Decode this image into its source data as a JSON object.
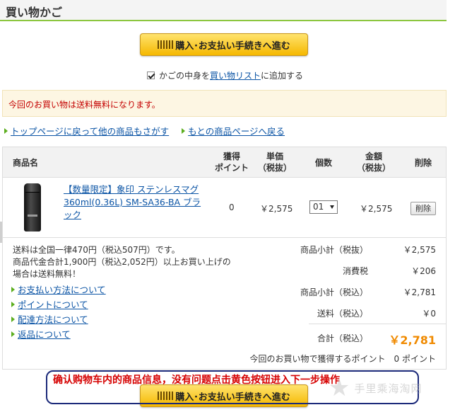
{
  "header": {
    "title": "買い物かご"
  },
  "buttons": {
    "checkout_top": "購入･お支払い手続きへ進む",
    "checkout_bottom": "購入･お支払い手続きへ進む"
  },
  "wishlist": {
    "checked": true,
    "prefix": "かごの中身を",
    "link": "買い物リスト",
    "suffix": "に追加する"
  },
  "notice": "今回のお買い物は送料無料になります。",
  "nav_links": [
    "トップページに戻って他の商品もさがす",
    "もとの商品ページへ戻る"
  ],
  "table": {
    "headers": {
      "product": "商品名",
      "points": [
        "獲得",
        "ポイント"
      ],
      "unit_price": [
        "単価",
        "（税抜）"
      ],
      "qty": "個数",
      "amount": [
        "金額",
        "（税抜）"
      ],
      "delete": "削除"
    },
    "item": {
      "name": "【数量限定】象印 ステンレスマグ 360ml(0.36L) SM-SA36-BA ブラック",
      "points": "0",
      "unit_price": "￥2,575",
      "qty": "01",
      "amount": "￥2,575",
      "delete_label": "削除"
    }
  },
  "shipping_info": [
    "送料は全国一律470円（税込507円）です。",
    "商品代金合計1,900円（税込2,052円）以上お買い上げの",
    "場合は送料無料！"
  ],
  "info_links": [
    "お支払い方法について",
    "ポイントについて",
    "配達方法について",
    "返品について"
  ],
  "summary": {
    "subtotal_ex_label": "商品小計（税抜）",
    "subtotal_ex": "￥2,575",
    "tax_label": "消費税",
    "tax": "￥206",
    "subtotal_in_label": "商品小計（税込）",
    "subtotal_in": "￥2,781",
    "shipping_label": "送料（税込）",
    "shipping": "￥0",
    "total_label": "合計（税込）",
    "total": "￥2,781",
    "points_text": "今回のお買い物で獲得するポイント　0 ポイント"
  },
  "annotation": "确认购物车内的商品信息，没有问题点击黄色按钮进入下一步操作",
  "watermark": "手里乘海淘网",
  "colors": {
    "accent_green": "#8cc63f",
    "link": "#0b54a5",
    "notice_red": "#c40000",
    "total_orange": "#f08a00",
    "button_yellow": "#f5b800"
  }
}
